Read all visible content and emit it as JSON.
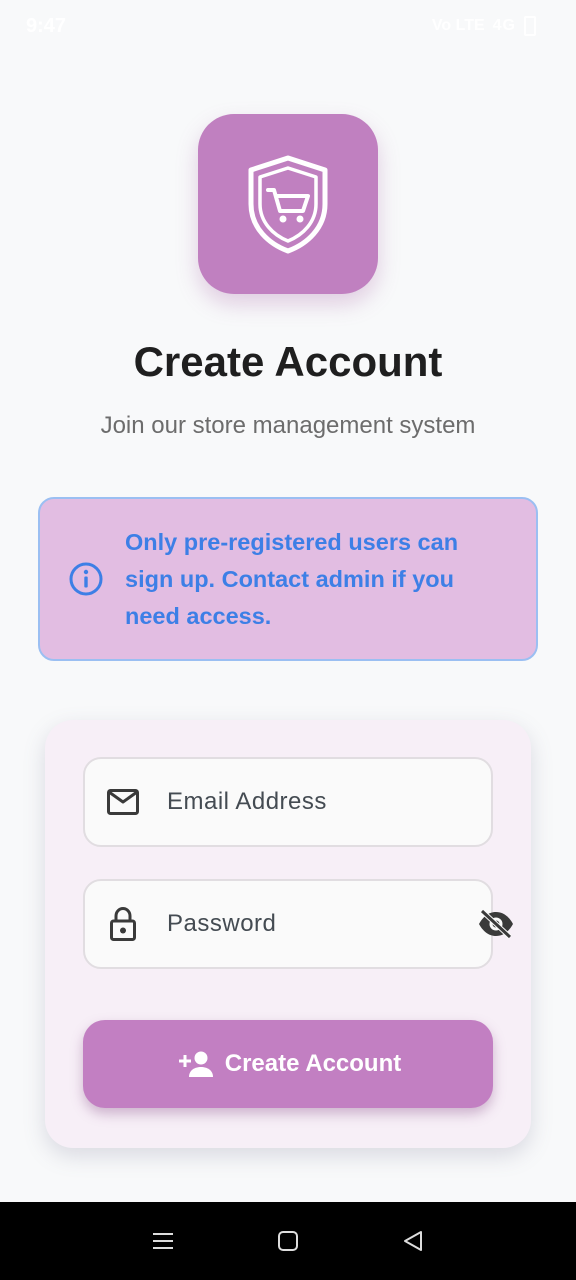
{
  "status_bar": {
    "time": "9:47",
    "network": "Vo LTE",
    "signal": "4G"
  },
  "header": {
    "logo_icon": "shield-cart-icon",
    "title": "Create Account",
    "subtitle": "Join our store management system"
  },
  "info_banner": {
    "icon": "info-icon",
    "text": "Only pre-registered users can sign up. Contact admin if you need access."
  },
  "form": {
    "email": {
      "icon": "mail-icon",
      "value": "",
      "placeholder": "Email Address"
    },
    "password": {
      "icon": "lock-icon",
      "value": "",
      "placeholder": "Password",
      "visibility_icon": "eye-off-icon"
    },
    "submit": {
      "icon": "person-add-icon",
      "label": "Create Account"
    }
  },
  "navigation": {
    "items": [
      "menu-icon",
      "home-square-icon",
      "back-triangle-icon"
    ]
  },
  "colors": {
    "accent": "#c080c0",
    "background": "#f8f9fa",
    "card": "#f7eff7",
    "info_background": "#e2bde2",
    "info_border": "#9bbff2",
    "info_text": "#3d7fe6",
    "title": "#1f1f1f",
    "subtitle": "#6c6c6c"
  }
}
